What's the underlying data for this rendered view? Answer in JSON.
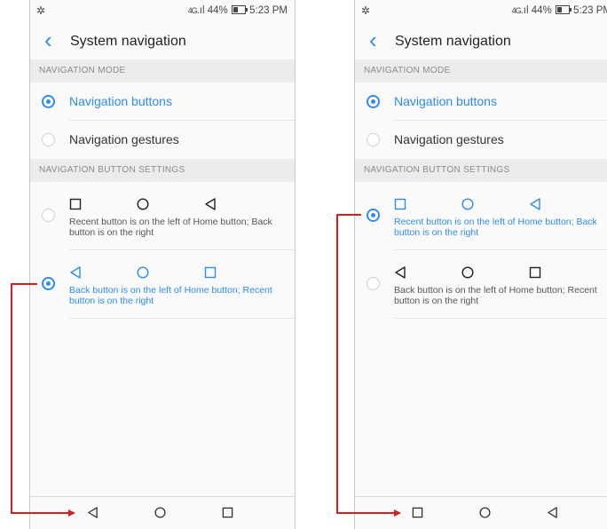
{
  "status": {
    "network": "4G",
    "battery": "44%",
    "time": "5:23 PM"
  },
  "header": {
    "title": "System navigation"
  },
  "sections": {
    "mode": "NAVIGATION MODE",
    "buttons": "NAVIGATION BUTTON SETTINGS"
  },
  "modes": {
    "buttons": "Navigation buttons",
    "gestures": "Navigation gestures"
  },
  "left": {
    "option1_desc": "Recent button is on the left of Home button; Back button is on the right",
    "option2_desc": "Back button is on the left of Home button; Recent button is on the right",
    "selected_option": 2
  },
  "right": {
    "option1_desc": "Recent button is on the left of Home button; Back button is on the right",
    "option2_desc": "Back button is on the left of Home button; Recent button is on the right",
    "selected_option": 1
  },
  "colors": {
    "accent": "#2d8cf0",
    "arrow": "#d62020"
  }
}
